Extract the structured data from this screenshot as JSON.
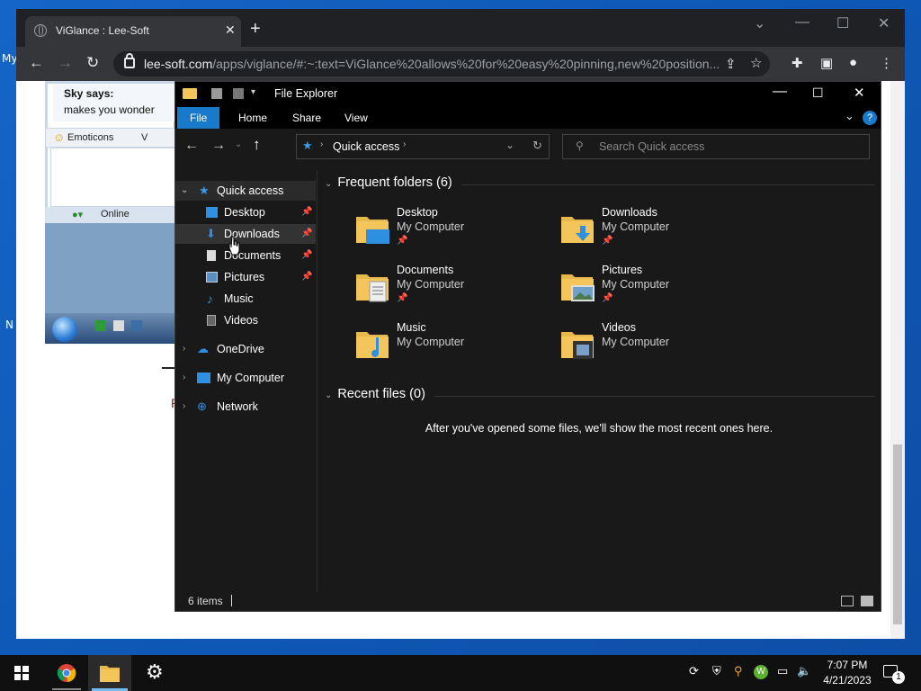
{
  "desktop": {
    "left_label_1": "My",
    "left_label_2": "N"
  },
  "browser": {
    "tab_title": "ViGlance : Lee-Soft",
    "url_domain": "lee-soft.com",
    "url_path": "/apps/viglance/#:~:text=ViGlance%20allows%20for%20easy%20pinning,new%20position..."
  },
  "embedded_page": {
    "chat_name": "Sky says:",
    "chat_msg": "makes you wonder",
    "emoticons_label": "Emoticons",
    "emoticons_extra": "V",
    "status_label": "Online",
    "below_text": "P"
  },
  "explorer": {
    "window_title": "File Explorer",
    "ribbon_tabs": [
      "File",
      "Home",
      "Share",
      "View"
    ],
    "address_crumb": "Quick access",
    "search_placeholder": "Search Quick access",
    "sidebar": {
      "quick_access": "Quick access",
      "items": [
        {
          "label": "Desktop",
          "pinned": true
        },
        {
          "label": "Downloads",
          "pinned": true
        },
        {
          "label": "Documents",
          "pinned": true
        },
        {
          "label": "Pictures",
          "pinned": true
        },
        {
          "label": "Music",
          "pinned": false
        },
        {
          "label": "Videos",
          "pinned": false
        }
      ],
      "onedrive": "OneDrive",
      "my_computer": "My Computer",
      "network": "Network"
    },
    "frequent_header": "Frequent folders (6)",
    "folders": [
      {
        "name": "Desktop",
        "location": "My Computer",
        "pinned": true
      },
      {
        "name": "Downloads",
        "location": "My Computer",
        "pinned": true
      },
      {
        "name": "Documents",
        "location": "My Computer",
        "pinned": true
      },
      {
        "name": "Pictures",
        "location": "My Computer",
        "pinned": true
      },
      {
        "name": "Music",
        "location": "My Computer",
        "pinned": false
      },
      {
        "name": "Videos",
        "location": "My Computer",
        "pinned": false
      }
    ],
    "recent_header": "Recent files (0)",
    "recent_empty": "After you've opened some files, we'll show the most recent ones here.",
    "status_items": "6 items"
  },
  "taskbar": {
    "time": "7:07 PM",
    "date": "4/21/2023",
    "notification_count": "1"
  },
  "colors": {
    "desktop_blue": "#1565c8",
    "explorer_bg": "#191919",
    "ribbon_file": "#1979ca",
    "folder_yellow": "#f4c55a"
  }
}
